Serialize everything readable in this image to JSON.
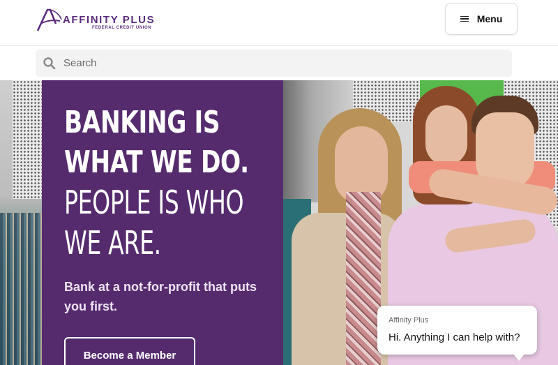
{
  "header": {
    "logo": {
      "name": "AFFINITY PLUS",
      "sub": "FEDERAL CREDIT UNION",
      "mark_icon": "affinity-a-logo"
    },
    "menu": {
      "label": "Menu",
      "icon": "hamburger-icon"
    }
  },
  "search": {
    "placeholder": "Search",
    "value": "",
    "icon": "search-icon"
  },
  "hero": {
    "headline_bold": [
      "BANKING IS",
      "WHAT WE DO."
    ],
    "headline_light": [
      "PEOPLE IS WHO",
      "WE ARE."
    ],
    "subtext": "Bank at a not-for-profit that puts you first.",
    "cta_label": "Become a Member"
  },
  "chat": {
    "from": "Affinity Plus",
    "message": "Hi. Anything I can help with?"
  },
  "colors": {
    "brand_purple": "#552b6e",
    "logo_purple": "#5b2c7e",
    "search_bg": "#f3f3f3"
  }
}
